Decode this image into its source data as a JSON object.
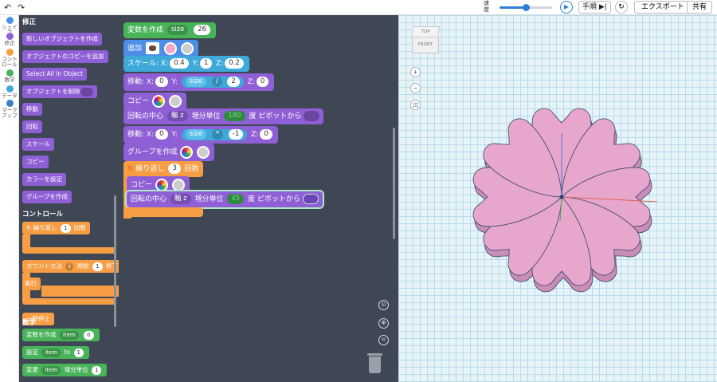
{
  "topbar": {
    "undo_icon": "↶",
    "redo_icon": "↷",
    "speed_label": "速度",
    "speed_value": 0.5,
    "play_icon": "▶",
    "step_label": "手順",
    "step_icon": "▶|",
    "reset_icon": "↻",
    "export_label": "エクスポート",
    "share_label": "共有"
  },
  "categories": [
    {
      "label": "シェイプ",
      "color": "#4d8fe8"
    },
    {
      "label": "修正",
      "color": "#8f5fd6"
    },
    {
      "label": "コントロール",
      "color": "#f79e44"
    },
    {
      "label": "数学",
      "color": "#49b35a"
    },
    {
      "label": "データ",
      "color": "#3fa9d9"
    },
    {
      "label": "マークアップ",
      "color": "#3a7fc6"
    }
  ],
  "flyout": {
    "section_modify": "修正",
    "create_object": "新しいオブジェクトを作成",
    "add_copy": "オブジェクトのコピーを追加",
    "select_all": "Select All In Object",
    "delete_object": "オブジェクトを削除",
    "move": "移動",
    "rotate": "回転",
    "scale": "スケール",
    "copy": "コピー",
    "set_color": "カラーを設定",
    "group": "グループを作成",
    "section_control": "コントロール",
    "repeat_label": "繰り返し",
    "repeat_value": "1",
    "repeat_unit": "回数",
    "count_label": "カウント方法",
    "count_var": "i",
    "count_from": "開始",
    "count_from_value": "1",
    "count_end": "終了",
    "do_label": "実行",
    "pause": "一時停止",
    "section_math": "数学",
    "create_var": "変数を作成",
    "create_var_name": "item",
    "create_var_value": "0",
    "set_label": "設定",
    "set_var": "item",
    "set_to": "to",
    "set_value": "1",
    "change_label": "変更",
    "change_var": "item",
    "change_by": "増分単位",
    "change_value": "1"
  },
  "workspace": {
    "create_var_label": "変数を作成",
    "create_var_name": "size",
    "create_var_value": "26",
    "add_label": "追加",
    "scale_label": "スケール:",
    "scale_x_label": "X:",
    "scale_x": "0.4",
    "scale_y_label": "Y:",
    "scale_y": "1",
    "scale_z_label": "Z:",
    "scale_z": "0.2",
    "move1_label": "移動:",
    "move1_x_label": "X:",
    "move1_x": "0",
    "move1_y_label": "Y:",
    "move1_y_var": "size",
    "move1_op": "/",
    "move1_y_num": "2",
    "move1_z_label": "Z:",
    "move1_z": "0",
    "copy1_label": "コピー",
    "rotate1_label": "回転の中心",
    "rotate1_axis": "軸 z",
    "rotate1_by": "増分単位",
    "rotate1_value": "180",
    "rotate1_unit": "度",
    "rotate1_pivot": "ピボットから",
    "move2_label": "移動:",
    "move2_x_label": "X:",
    "move2_x": "0",
    "move2_y_label": "Y:",
    "move2_y_var": "size",
    "move2_op": "*",
    "move2_y_num": "-1",
    "move2_z_label": "Z:",
    "move2_z": "0",
    "group_label": "グループを作成",
    "repeat_label": "繰り返し",
    "repeat_value": "3",
    "repeat_unit": "回数",
    "copy2_label": "コピー",
    "rotate2_label": "回転の中心",
    "rotate2_axis": "軸 z",
    "rotate2_by": "増分単位",
    "rotate2_value": "45",
    "rotate2_unit": "度",
    "rotate2_pivot": "ピボットから",
    "tools": {
      "zoom_reset": "⊙",
      "zoom_in": "⊕",
      "zoom_out": "="
    }
  },
  "viewport": {
    "viewcube_top": "TOP",
    "viewcube_front": "FRONT",
    "zoom_in_icon": "+",
    "zoom_out_icon": "−",
    "fit_icon": "⊡",
    "petal_color": "#e7a7cd",
    "petal_side_color": "#c98db8",
    "outline_color": "#3a4a6a"
  }
}
